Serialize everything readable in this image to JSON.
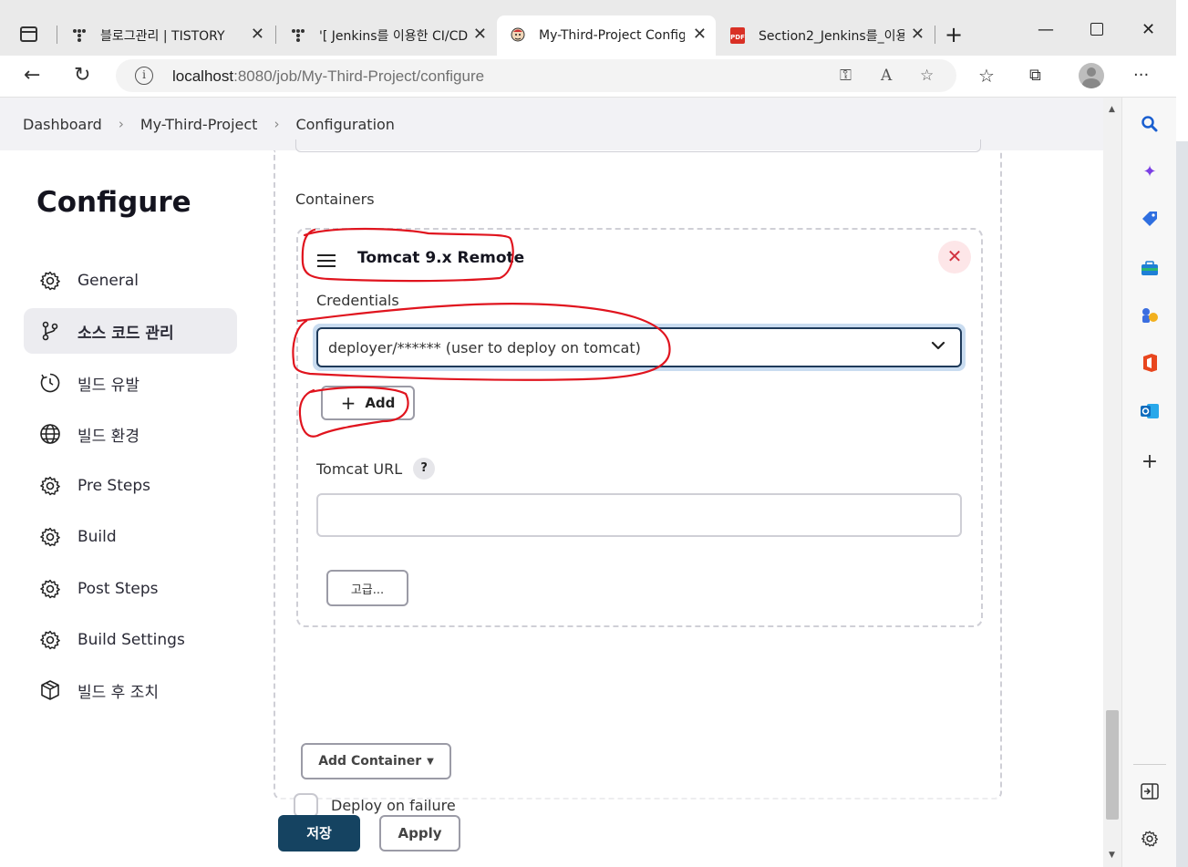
{
  "browser": {
    "tabs": [
      {
        "title": "블로그관리 | TISTORY",
        "icon": "tistory-icon"
      },
      {
        "title": "'[ Jenkins를 이용한 CI/CD",
        "icon": "tistory-icon"
      },
      {
        "title": "My-Third-Project Config",
        "icon": "jenkins-icon",
        "active": true
      },
      {
        "title": "Section2_Jenkins를_이용",
        "icon": "pdf-icon"
      }
    ],
    "url_host": "localhost",
    "url_rest": ":8080/job/My-Third-Project/configure",
    "pdf_badge": "PDF"
  },
  "breadcrumb": [
    "Dashboard",
    "My-Third-Project",
    "Configuration"
  ],
  "sidebar": {
    "title": "Configure",
    "items": [
      {
        "label": "General",
        "icon": "gear-icon"
      },
      {
        "label": "소스 코드 관리",
        "icon": "branch-icon",
        "active": true
      },
      {
        "label": "빌드 유발",
        "icon": "clock-icon"
      },
      {
        "label": "빌드 환경",
        "icon": "globe-icon"
      },
      {
        "label": "Pre Steps",
        "icon": "gear-icon"
      },
      {
        "label": "Build",
        "icon": "gear-icon"
      },
      {
        "label": "Post Steps",
        "icon": "gear-icon"
      },
      {
        "label": "Build Settings",
        "icon": "gear-icon"
      },
      {
        "label": "빌드 후 조치",
        "icon": "package-icon"
      }
    ]
  },
  "form": {
    "containers_label": "Containers",
    "container": {
      "title": "Tomcat 9.x Remote",
      "remove_symbol": "✕",
      "credentials_label": "Credentials",
      "credentials_value": "deployer/****** (user to deploy on tomcat)",
      "add_label": "Add",
      "tomcat_url_label": "Tomcat URL",
      "help_symbol": "?",
      "tomcat_url_value": "",
      "advanced_label": "고급..."
    },
    "add_container_label": "Add Container",
    "deploy_on_failure_label": "Deploy on failure",
    "deploy_on_failure_checked": false
  },
  "actions": {
    "save_label": "저장",
    "apply_label": "Apply"
  },
  "colors": {
    "save_bg": "#154361",
    "annotation_red": "#e0141e",
    "remove_bg": "#fde6e8",
    "select_focus": "#1e3a5a"
  }
}
